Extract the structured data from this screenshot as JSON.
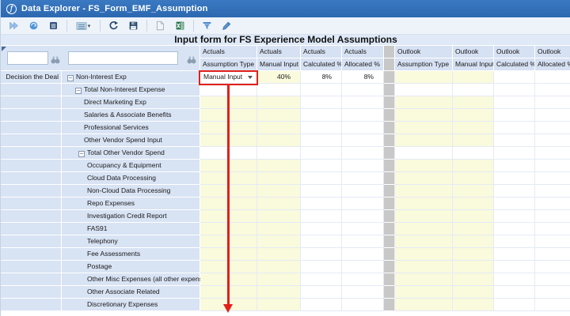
{
  "window": {
    "title": "Data Explorer - FS_Form_EMF_Assumption"
  },
  "toolbar": {
    "icon_names": [
      "run-icon",
      "refresh-data-icon",
      "data-rows-icon",
      "layout-icon",
      "refresh-icon",
      "save-icon",
      "export-document-icon",
      "export-excel-icon",
      "filter-icon",
      "edit-pencil-icon"
    ]
  },
  "form": {
    "title": "Input form for FS Experience Model Assumptions"
  },
  "grid": {
    "corner_label": "Decision the Deal",
    "search_boxes": [
      {
        "value": ""
      },
      {
        "value": ""
      }
    ],
    "column_groups": [
      "Actuals",
      "Outlook"
    ],
    "columns": [
      "Assumption Type",
      "Manual Input",
      "Calculated %",
      "Allocated %"
    ],
    "rows": [
      {
        "label": "Non-Interest Exp",
        "level": 0,
        "expandable": true,
        "kind": "first",
        "actuals": {
          "assumption_type": "Manual Input",
          "manual_input": "40%",
          "calculated_pct": "8%",
          "allocated_pct": "8%"
        },
        "outlook": {
          "assumption_type": "",
          "manual_input": "",
          "calculated_pct": "",
          "allocated_pct": ""
        }
      },
      {
        "label": "Total Non-Interest Expense",
        "level": 1,
        "expandable": true,
        "kind": "total"
      },
      {
        "label": "Direct Marketing Exp",
        "level": 2,
        "expandable": false,
        "kind": "input"
      },
      {
        "label": "Salaries & Associate Benefits",
        "level": 2,
        "expandable": false,
        "kind": "input"
      },
      {
        "label": "Professional Services",
        "level": 2,
        "expandable": false,
        "kind": "input"
      },
      {
        "label": "Other Vendor Spend Input",
        "level": 2,
        "expandable": false,
        "kind": "input"
      },
      {
        "label": "Total Other Vendor Spend",
        "level": 2,
        "expandable": true,
        "kind": "total"
      },
      {
        "label": "Occupancy & Equipment",
        "level": 3,
        "expandable": false,
        "kind": "input"
      },
      {
        "label": "Cloud Data Processing",
        "level": 3,
        "expandable": false,
        "kind": "input"
      },
      {
        "label": "Non-Cloud Data Processing",
        "level": 3,
        "expandable": false,
        "kind": "input"
      },
      {
        "label": "Repo Expenses",
        "level": 3,
        "expandable": false,
        "kind": "input"
      },
      {
        "label": "Investigation Credit Report",
        "level": 3,
        "expandable": false,
        "kind": "input"
      },
      {
        "label": "FAS91",
        "level": 3,
        "expandable": false,
        "kind": "input"
      },
      {
        "label": "Telephony",
        "level": 3,
        "expandable": false,
        "kind": "input"
      },
      {
        "label": "Fee Assessments",
        "level": 3,
        "expandable": false,
        "kind": "input"
      },
      {
        "label": "Postage",
        "level": 3,
        "expandable": false,
        "kind": "input"
      },
      {
        "label": "Other Misc Expenses (all other expenses)",
        "level": 3,
        "expandable": false,
        "kind": "input"
      },
      {
        "label": "Other Associate Related",
        "level": 3,
        "expandable": false,
        "kind": "input"
      },
      {
        "label": "Discretionary Expenses",
        "level": 3,
        "expandable": false,
        "kind": "input"
      }
    ]
  },
  "highlight": {
    "dropdown_value": "Manual Input"
  },
  "colors": {
    "titlebar_blue": "#2e6cb6",
    "accent_red": "#e3201b",
    "editable_yellow": "#fafadd",
    "panel_blue": "#d8e3f4",
    "header_blue": "#d6e1f3",
    "gap_gray": "#c8c8c8",
    "excel_green": "#1e7145"
  }
}
